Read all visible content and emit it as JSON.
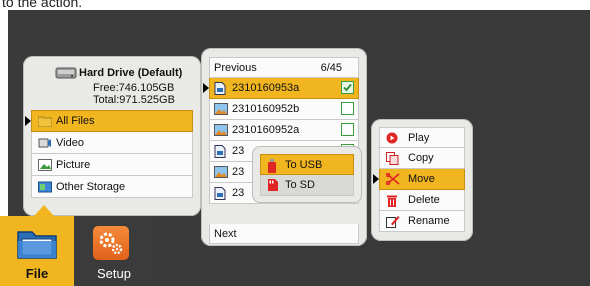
{
  "header_text": "to the action.",
  "drive": {
    "name": "Hard Drive (Default)",
    "free": "Free:746.105GB",
    "total": "Total:971.525GB",
    "items": [
      {
        "label": "All Files",
        "icon": "folder-icon",
        "selected": true
      },
      {
        "label": "Video",
        "icon": "video-icon",
        "selected": false
      },
      {
        "label": "Picture",
        "icon": "picture-icon",
        "selected": false
      },
      {
        "label": "Other Storage",
        "icon": "storage-icon",
        "selected": false
      }
    ]
  },
  "files": {
    "previous": "Previous",
    "page": "6/45",
    "next": "Next",
    "rows": [
      {
        "name": "2310160953a",
        "icon": "video-file-icon",
        "checked": true,
        "selected": true
      },
      {
        "name": "2310160952b",
        "icon": "image-file-icon",
        "checked": false,
        "selected": false
      },
      {
        "name": "2310160952a",
        "icon": "image-file-icon",
        "checked": false,
        "selected": false
      },
      {
        "name": "23",
        "icon": "video-file-icon",
        "checked": false,
        "selected": false
      },
      {
        "name": "23",
        "icon": "image-file-icon",
        "checked": false,
        "selected": false
      },
      {
        "name": "23",
        "icon": "video-file-icon",
        "checked": false,
        "selected": false
      }
    ]
  },
  "move_menu": {
    "items": [
      {
        "label": "To USB",
        "icon": "usb-icon",
        "selected": true
      },
      {
        "label": "To SD",
        "icon": "sd-card-icon",
        "selected": false
      }
    ]
  },
  "action_menu": {
    "items": [
      {
        "label": "Play",
        "icon": "play-icon",
        "selected": false
      },
      {
        "label": "Copy",
        "icon": "copy-icon",
        "selected": false
      },
      {
        "label": "Move",
        "icon": "scissors-icon",
        "selected": true
      },
      {
        "label": "Delete",
        "icon": "trash-icon",
        "selected": false
      },
      {
        "label": "Rename",
        "icon": "rename-icon",
        "selected": false
      }
    ]
  },
  "tabs": {
    "file_label": "File",
    "setup_label": "Setup"
  },
  "colors": {
    "highlight": "#f1b51f",
    "panel": "#e9e9e6",
    "background": "#3a3a3a",
    "setup_orange": "#f0792b",
    "check_green": "#2f8f2f"
  }
}
